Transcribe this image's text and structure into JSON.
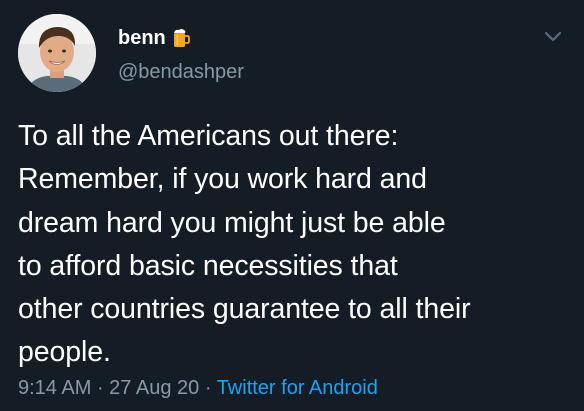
{
  "tweet": {
    "author": {
      "display_name": "benn",
      "name_emoji": "beer-mug-icon",
      "handle": "@bendashper"
    },
    "menu_icon": "chevron-down-icon",
    "text": "To all the Americans out there:\nRemember, if you work hard and\ndream hard you might just be able\nto afford basic necessities that\nother countries guarantee to all their\npeople.",
    "time": "9:14 AM",
    "separator": " · ",
    "date": "27 Aug 20",
    "source": "Twitter for Android"
  },
  "colors": {
    "background": "#141d26",
    "text_primary": "#ffffff",
    "text_secondary": "#8899a6",
    "link": "#1da1f2"
  }
}
